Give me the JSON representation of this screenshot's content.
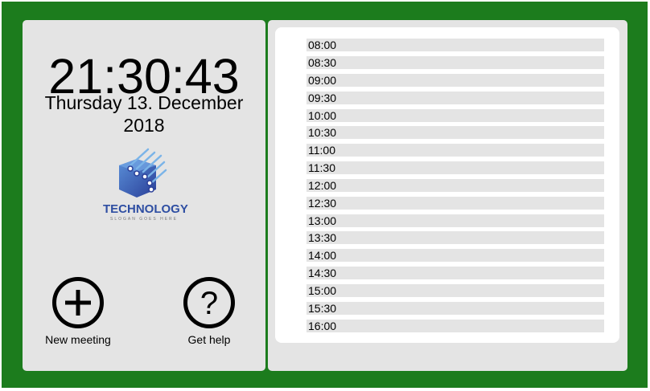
{
  "clock": {
    "time": "21:30:43"
  },
  "date": {
    "line1": "Thursday 13. December",
    "line2": "2018"
  },
  "logo": {
    "name": "TECHNOLOGY",
    "slogan": "SLOGAN GOES HERE",
    "icon": "cube-circuit-icon"
  },
  "actions": {
    "new_meeting": {
      "label": "New meeting",
      "icon": "plus-circle-icon"
    },
    "get_help": {
      "label": "Get help",
      "icon": "question-circle-icon"
    }
  },
  "schedule": {
    "slots": [
      "08:00",
      "08:30",
      "09:00",
      "09:30",
      "10:00",
      "10:30",
      "11:00",
      "11:30",
      "12:00",
      "12:30",
      "13:00",
      "13:30",
      "14:00",
      "14:30",
      "15:00",
      "15:30",
      "16:00"
    ]
  },
  "colors": {
    "frame": "#1c7c1d",
    "panel": "#e4e4e4",
    "logo": "#2e4ea2"
  }
}
